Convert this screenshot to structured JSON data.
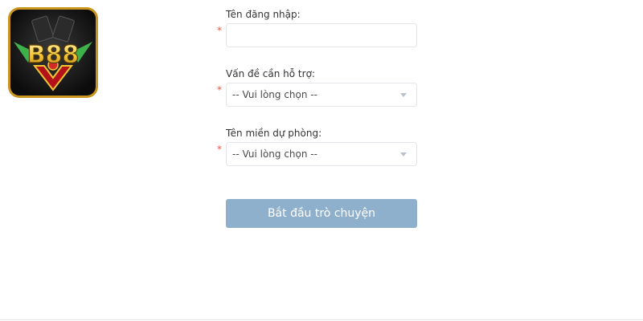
{
  "logo": {
    "text": "B88"
  },
  "form": {
    "username": {
      "label": "Tên đăng nhập:",
      "required_mark": "*",
      "value": ""
    },
    "support_issue": {
      "label": "Vấn đề cần hỗ trợ:",
      "required_mark": "*",
      "selected": "-- Vui lòng chọn --"
    },
    "backup_domain": {
      "label": "Tên miền dự phòng:",
      "required_mark": "*",
      "selected": "-- Vui lòng chọn --"
    },
    "submit_label": "Bắt đầu trò chuyện"
  },
  "colors": {
    "button": "#8fb0cc",
    "required": "#e8553e",
    "logo_gold": "#c9951e",
    "logo_red": "#b3121b"
  },
  "icons": [
    "chevron-down-icon",
    "b88-logo"
  ]
}
